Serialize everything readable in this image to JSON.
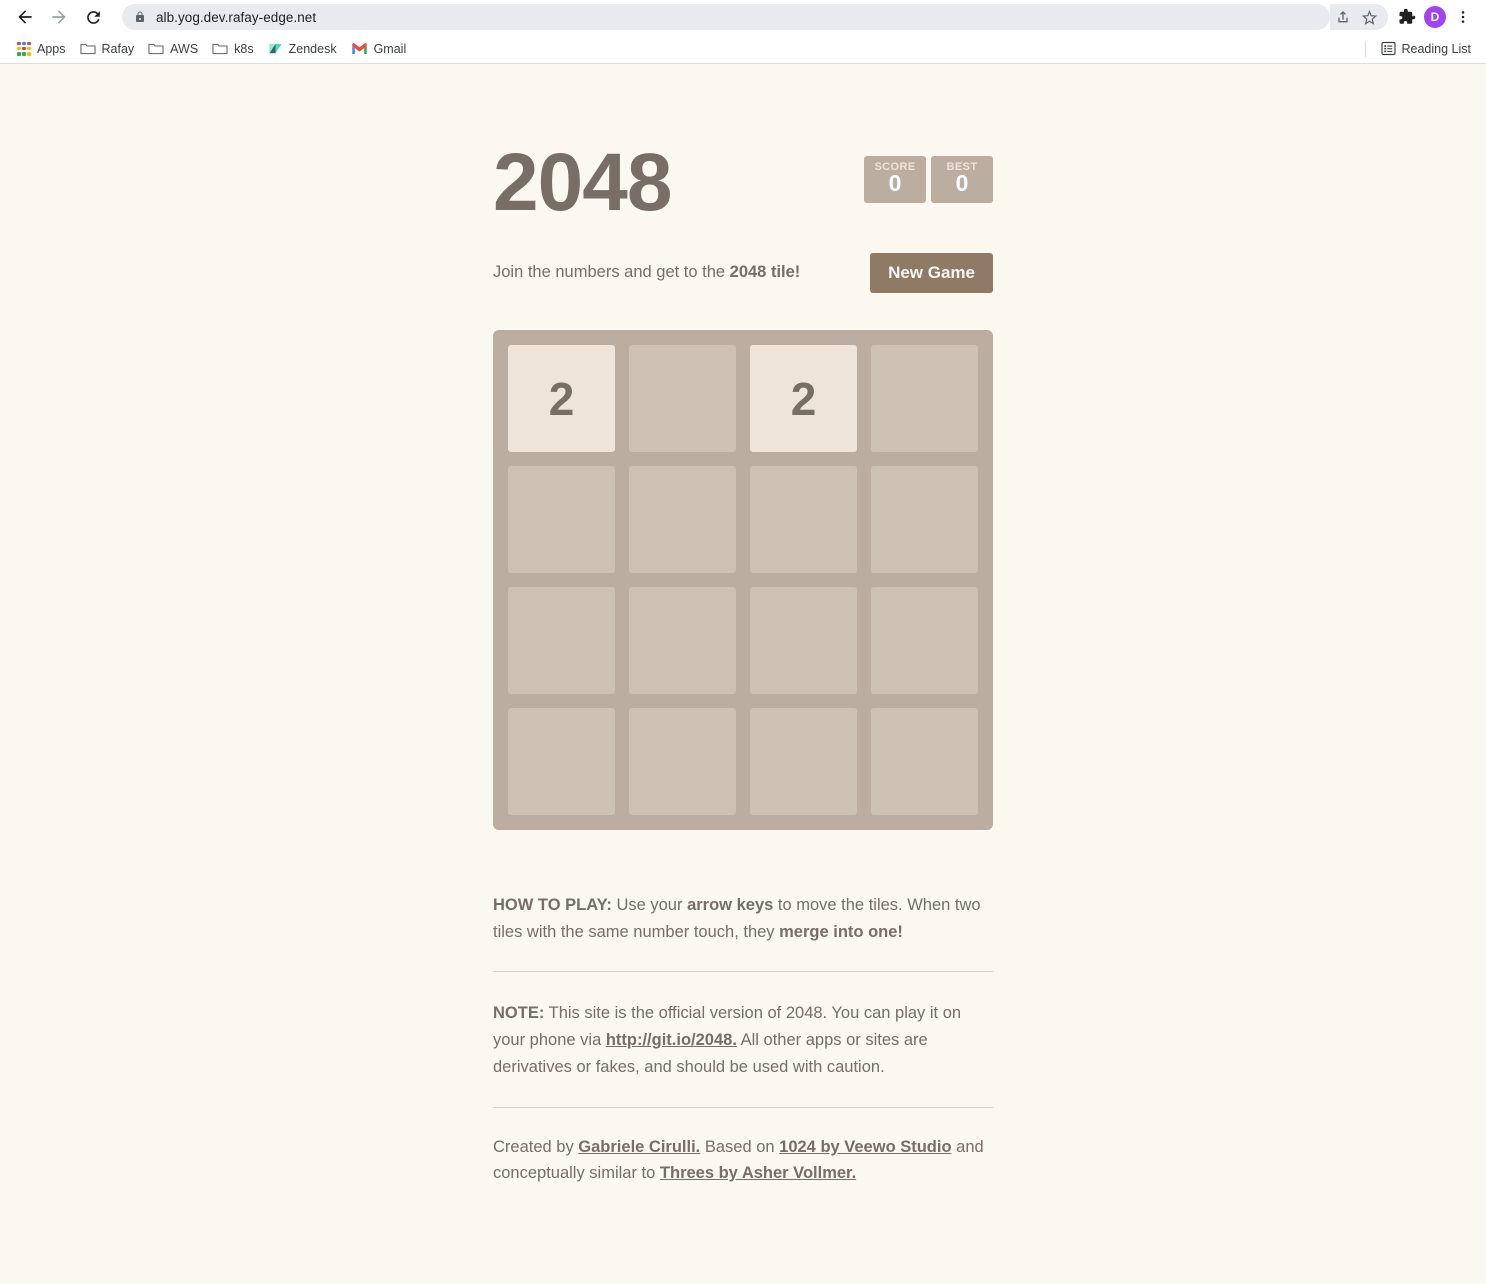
{
  "browser": {
    "back_icon": "back-arrow-icon",
    "forward_icon": "forward-arrow-icon",
    "reload_icon": "reload-icon",
    "lock_icon": "lock-icon",
    "url": "alb.yog.dev.rafay-edge.net",
    "share_icon": "share-icon",
    "bookmark_icon": "star-icon",
    "extensions_icon": "puzzle-piece-icon",
    "profile_initial": "D",
    "profile_color": "#a142f4",
    "menu_icon": "three-dot-menu-icon",
    "bookmarks": [
      {
        "label": "Apps",
        "icon": "apps-grid-icon"
      },
      {
        "label": "Rafay",
        "icon": "folder-icon"
      },
      {
        "label": "AWS",
        "icon": "folder-icon"
      },
      {
        "label": "k8s",
        "icon": "folder-icon"
      },
      {
        "label": "Zendesk",
        "icon": "zendesk-icon"
      },
      {
        "label": "Gmail",
        "icon": "gmail-icon"
      }
    ],
    "reading_list": {
      "label": "Reading List",
      "icon": "reading-list-icon"
    }
  },
  "game": {
    "title": "2048",
    "score": {
      "label": "Score",
      "value": "0"
    },
    "best": {
      "label": "Best",
      "value": "0"
    },
    "intro_prefix": "Join the numbers and get to the ",
    "intro_strong": "2048 tile!",
    "new_game_label": "New Game",
    "board": {
      "rows": 4,
      "cols": 4,
      "tiles": [
        [
          "2",
          "",
          "2",
          ""
        ],
        [
          "",
          "",
          "",
          ""
        ],
        [
          "",
          "",
          "",
          ""
        ],
        [
          "",
          "",
          "",
          ""
        ]
      ]
    },
    "colors": {
      "page_background": "#faf8ef",
      "board_background": "#bbada0",
      "cell_background": "#cdc1b4",
      "tile_2_background": "#eee4da",
      "text": "#776e65",
      "button": "#8f7a66"
    }
  },
  "how_to_play": {
    "heading": "HOW TO PLAY:",
    "part1": " Use your ",
    "bold1": "arrow keys",
    "part2": " to move the tiles. When two tiles with the same number touch, they ",
    "bold2": "merge into one!"
  },
  "note": {
    "heading": "NOTE:",
    "part1": " This site is the official version of 2048. You can play it on your phone via ",
    "link": "http://git.io/2048.",
    "part2": " All other apps or sites are derivatives or fakes, and should be used with caution."
  },
  "credits": {
    "part1": "Created by ",
    "link1": "Gabriele Cirulli.",
    "part2": " Based on ",
    "link2": "1024 by Veewo Studio",
    "part3": " and conceptually similar to ",
    "link3": "Threes by Asher Vollmer."
  }
}
